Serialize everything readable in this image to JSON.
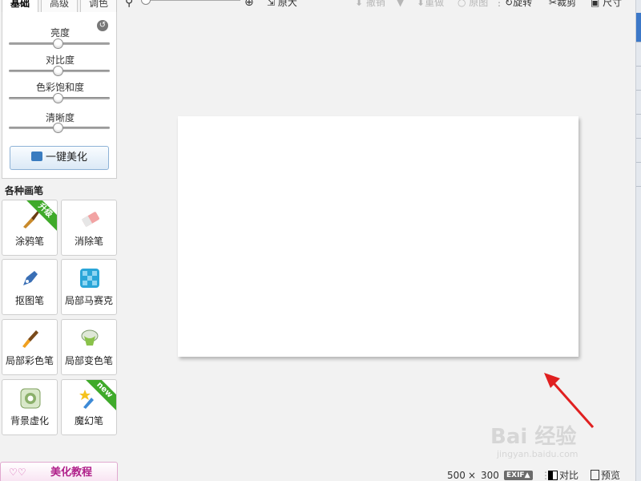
{
  "tabs": [
    "基础",
    "高级",
    "调色"
  ],
  "adjust": {
    "sliders": [
      {
        "label": "亮度",
        "value": 0.5
      },
      {
        "label": "对比度",
        "value": 0.5
      },
      {
        "label": "色彩饱和度",
        "value": 0.5
      },
      {
        "label": "清晰度",
        "value": 0.5
      }
    ],
    "one_click_label": "一键美化"
  },
  "brushes": {
    "title": "各种画笔",
    "items": [
      {
        "label": "涂鸦笔",
        "badge": "升级",
        "icon": "brush-icon"
      },
      {
        "label": "消除笔",
        "badge": "",
        "icon": "eraser-icon"
      },
      {
        "label": "抠图笔",
        "badge": "",
        "icon": "pen-icon"
      },
      {
        "label": "局部马赛克",
        "badge": "",
        "icon": "mosaic-icon"
      },
      {
        "label": "局部彩色笔",
        "badge": "",
        "icon": "color-brush-icon"
      },
      {
        "label": "局部变色笔",
        "badge": "",
        "icon": "bucket-icon"
      },
      {
        "label": "背景虚化",
        "badge": "",
        "icon": "blur-icon"
      },
      {
        "label": "魔幻笔",
        "badge": "new",
        "icon": "magic-wand-icon"
      }
    ]
  },
  "tutorial_label": "美化教程",
  "toolbar": {
    "original_size": "原大",
    "undo": "撤销",
    "redo": "重做",
    "original": "原图",
    "rotate": "旋转",
    "crop": "裁剪",
    "size": "尺寸"
  },
  "status": {
    "width": "500",
    "times": "×",
    "height": "300",
    "exif": "EXIF▲",
    "compare": "对比",
    "preview": "预览"
  },
  "watermark": {
    "line1": "Bai 经验",
    "line2": "jingyan.baidu.com"
  },
  "colors": {
    "accent": "#3c78c8",
    "ribbon_green": "#3faa2a",
    "arrow": "#e02020",
    "tutorial": "#b0208a"
  }
}
